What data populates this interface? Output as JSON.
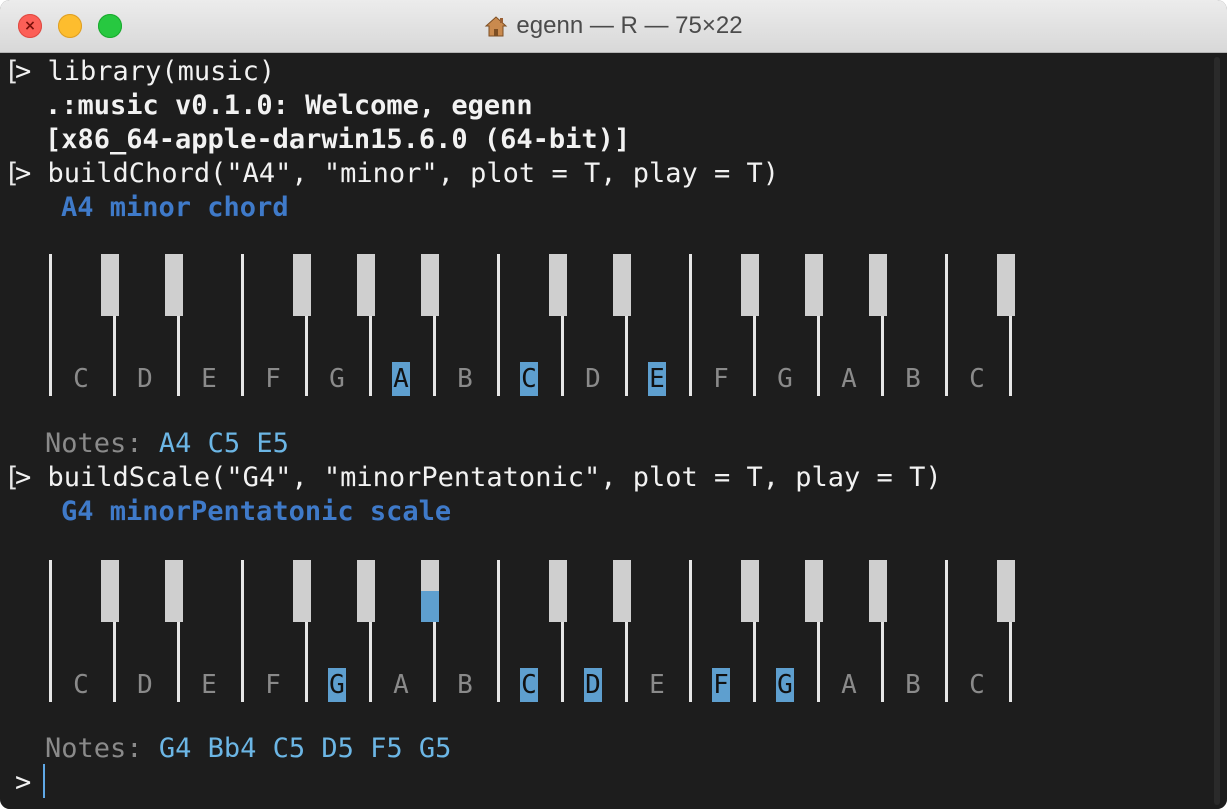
{
  "window": {
    "title": "egenn — R — 75×22",
    "title_icon": "home-icon"
  },
  "terminal": {
    "prompt": ">",
    "bracket": "[",
    "cmd1": "library(music)",
    "out1": ".:music v0.1.0: Welcome, egenn",
    "out2": "[x86_64-apple-darwin15.6.0 (64-bit)]",
    "cmd2": "buildChord(\"A4\", \"minor\", plot = T, play = T)",
    "chord_header": "A4 minor chord",
    "chord_notes_label": "Notes:",
    "chord_notes": "A4 C5 E5",
    "cmd3": "buildScale(\"G4\", \"minorPentatonic\", plot = T, play = T)",
    "scale_header": "G4 minorPentatonic scale",
    "scale_notes_label": "Notes:",
    "scale_notes": "G4 Bb4 C5 D5 F5 G5"
  },
  "keyboard": {
    "white_notes": [
      "C",
      "D",
      "E",
      "F",
      "G",
      "A",
      "B",
      "C",
      "D",
      "E",
      "F",
      "G",
      "A",
      "B",
      "C"
    ],
    "chord_highlight_white": [
      5,
      7,
      9
    ],
    "scale_highlight_white": [
      4,
      7,
      8,
      10,
      11
    ],
    "scale_highlight_black": [
      4
    ]
  },
  "colors": {
    "background": "#1d1d1d",
    "highlight": "#5e9fcf",
    "header_blue": "#3f7ac9",
    "notes_blue": "#6cb6e5"
  }
}
